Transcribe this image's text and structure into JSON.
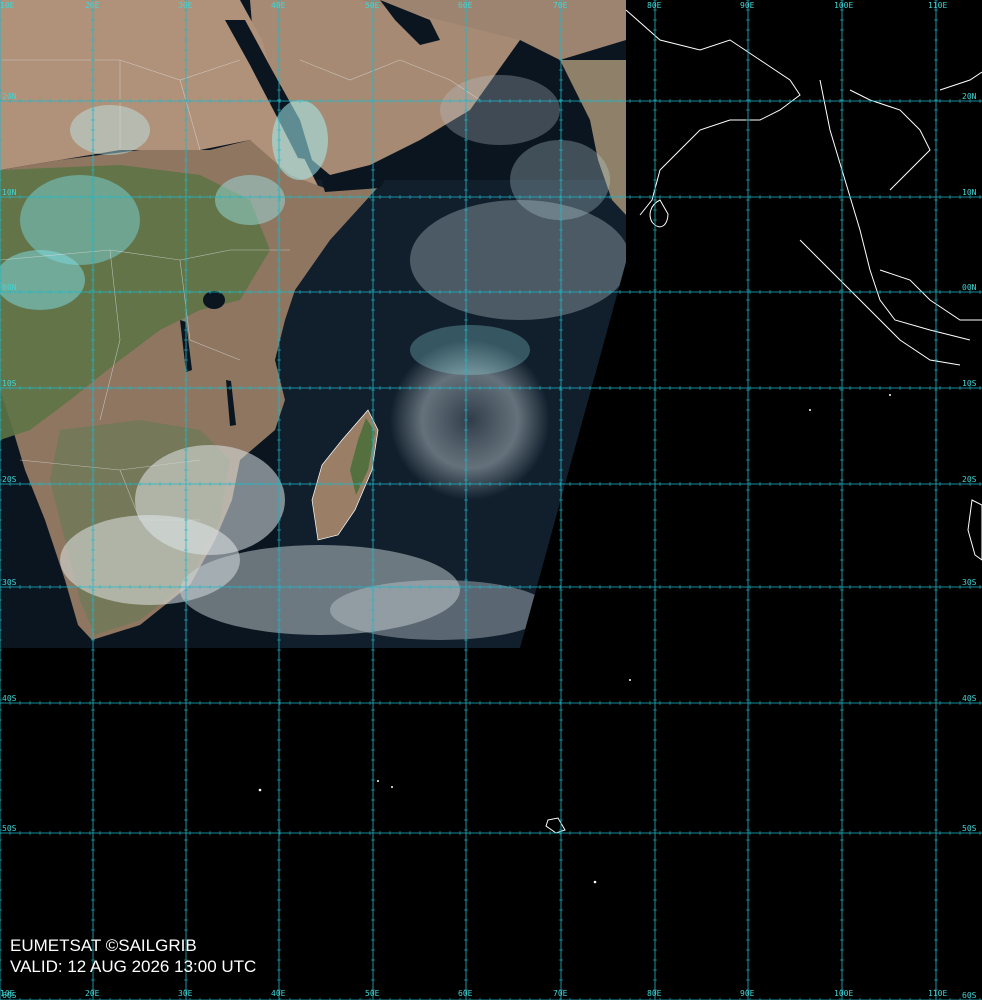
{
  "credits": {
    "source": "EUMETSAT ©SAILGRIB",
    "valid": "VALID:  12 AUG 2026 13:00 UTC"
  },
  "graticule": {
    "lon_labels": [
      "10E",
      "20E",
      "30E",
      "40E",
      "50E",
      "60E",
      "70E",
      "80E",
      "90E",
      "100E",
      "110E"
    ],
    "lat_labels": [
      "20N",
      "10N",
      "00N",
      "10S",
      "20S",
      "30S",
      "40S",
      "50S",
      "60S"
    ],
    "line_color": "#1fb8c8",
    "label_color": "#3fd6d6"
  },
  "colors": {
    "ocean": "#0b1520",
    "land_desert": "#a88a74",
    "land_vegetation": "#5d7446",
    "cloud_white": "#dfe8ea",
    "cloud_cyan": "#7fe0e8",
    "coastline_outline": "#ffffff"
  }
}
